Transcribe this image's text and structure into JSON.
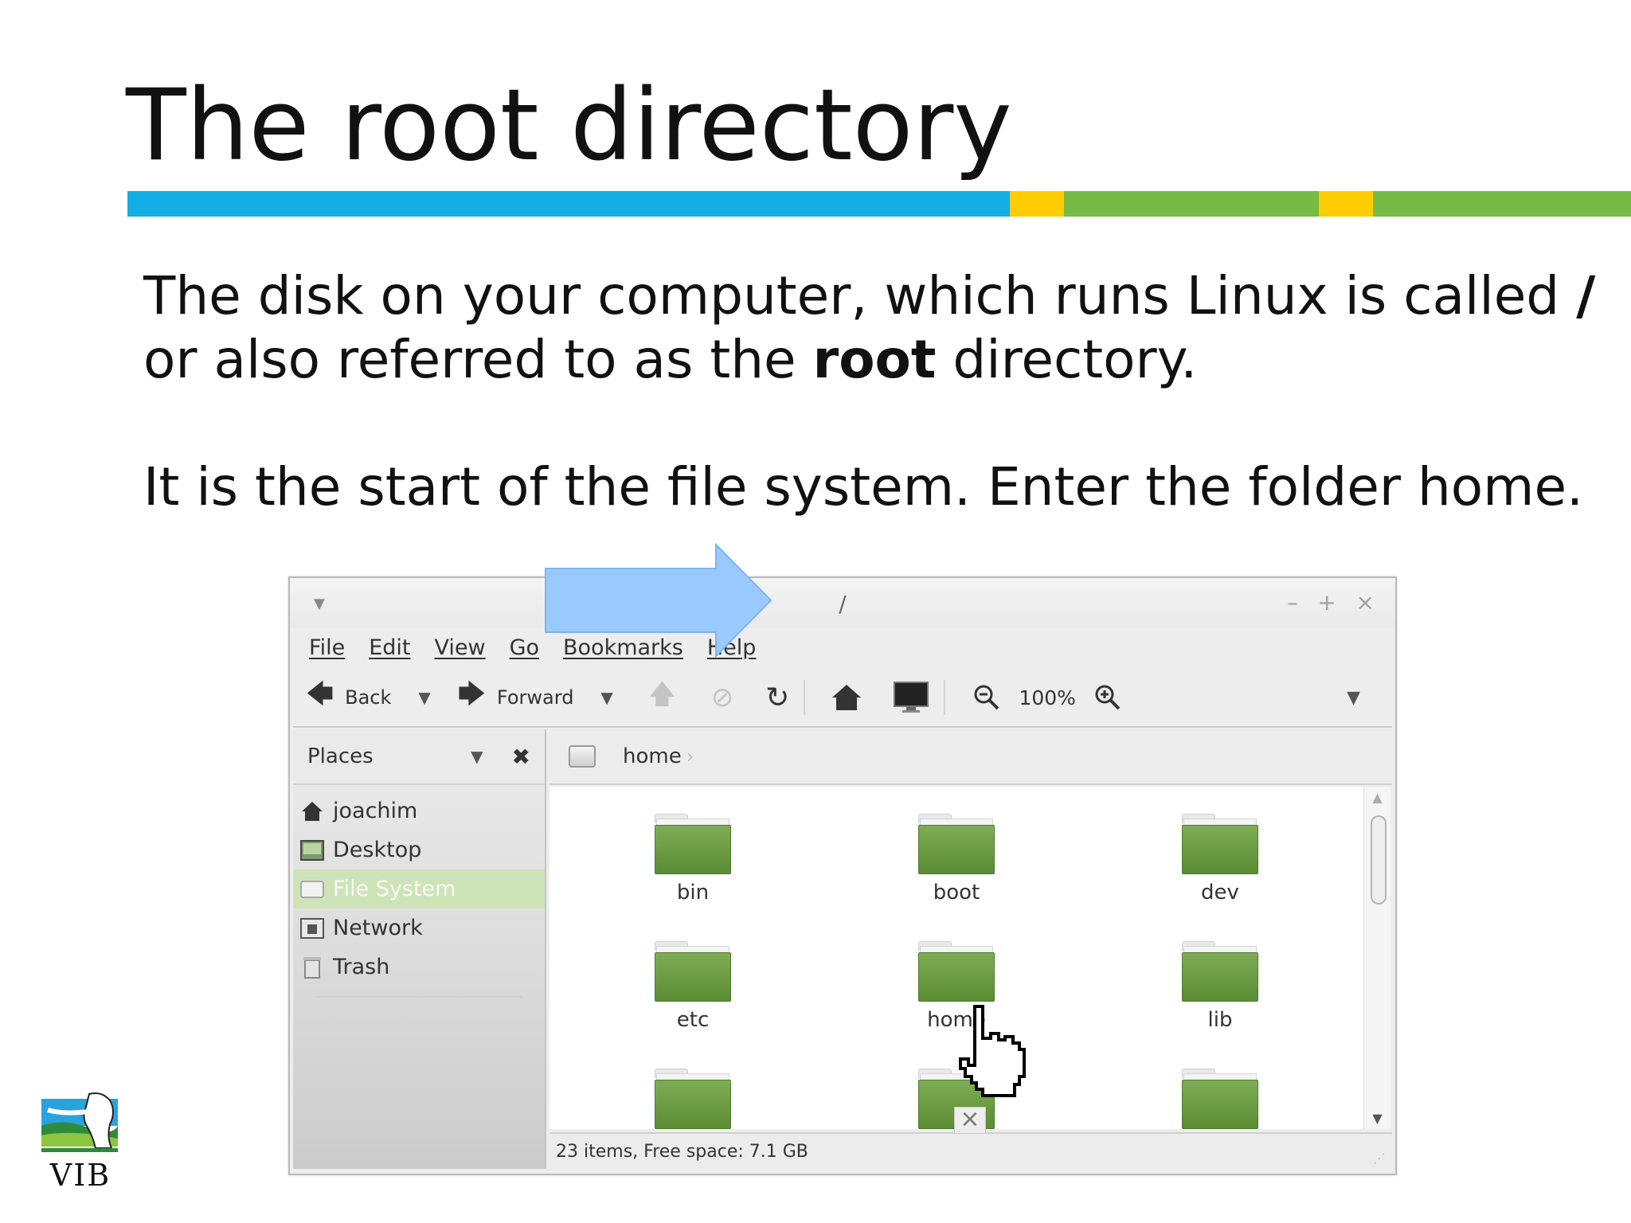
{
  "slide": {
    "title": "The root directory",
    "bar_colors": [
      "#13aee6",
      "#ffcc00",
      "#77bb44",
      "#ffcc00",
      "#77bb44"
    ],
    "para1": {
      "line1_text": "The disk on your computer, which runs Linux is called ",
      "line1_bold": "/",
      "line2_prefix": "or also referred to as the ",
      "line2_bold": "root",
      "line2_suffix": " directory."
    },
    "para2": "It is the start of the file system. Enter the folder home."
  },
  "window": {
    "title": "/",
    "menu": [
      "File",
      "Edit",
      "View",
      "Go",
      "Bookmarks",
      "Help"
    ],
    "toolbar": {
      "back_label": "Back",
      "forward_label": "Forward",
      "zoom_level": "100%"
    },
    "sidebar": {
      "header": "Places",
      "items": [
        {
          "label": "joachim",
          "icon": "home-icon"
        },
        {
          "label": "Desktop",
          "icon": "desktop-icon"
        },
        {
          "label": "File System",
          "icon": "drive-icon"
        },
        {
          "label": "Network",
          "icon": "network-icon"
        },
        {
          "label": "Trash",
          "icon": "trash-icon"
        }
      ],
      "selected_index": 2
    },
    "pathbar": {
      "crumb": "home"
    },
    "folders": [
      "bin",
      "boot",
      "dev",
      "etc",
      "home",
      "lib",
      "",
      "",
      ""
    ],
    "status": "23 items, Free space: 7.1 GB"
  },
  "logo": {
    "text": "VIB"
  }
}
